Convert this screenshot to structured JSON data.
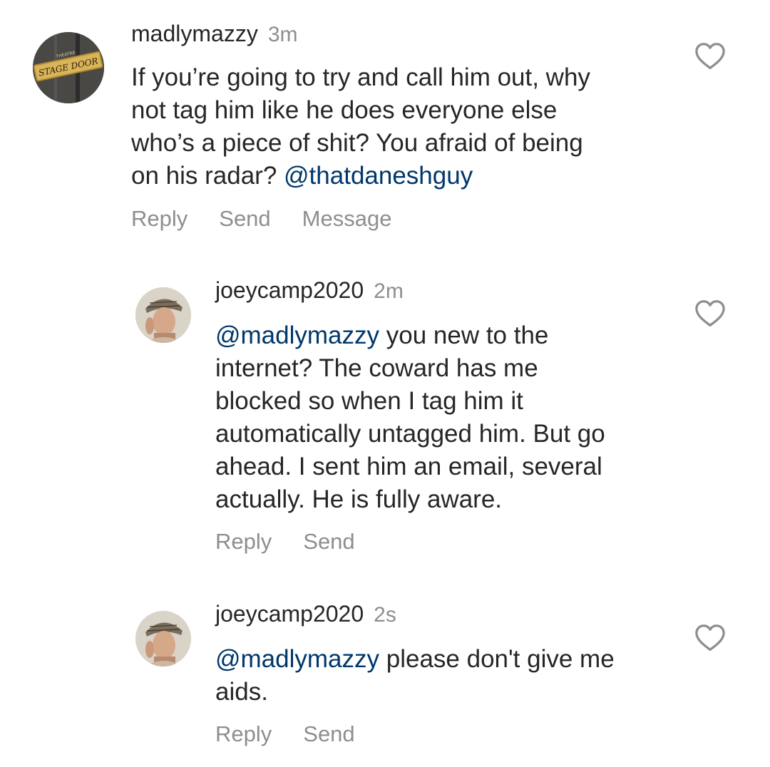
{
  "comments": [
    {
      "username": "madlymazzy",
      "time": "3m",
      "text_lines": [
        [
          {
            "t": "If you’re going to try and call him out, why"
          }
        ],
        [
          {
            "t": "not tag him like he does everyone else"
          }
        ],
        [
          {
            "t": "who’s a piece of shit? You afraid of being"
          }
        ],
        [
          {
            "t": "on his radar? "
          },
          {
            "t": "@thatdaneshguy",
            "m": true
          }
        ]
      ],
      "actions": [
        "Reply",
        "Send",
        "Message"
      ],
      "avatar_sign_top": "THEATRE",
      "avatar_sign_main": "STAGE DOOR"
    },
    {
      "username": "joeycamp2020",
      "time": "2m",
      "text_lines": [
        [
          {
            "t": "@madlymazzy",
            "m": true
          },
          {
            "t": " you new to the"
          }
        ],
        [
          {
            "t": "internet? The coward has me"
          }
        ],
        [
          {
            "t": "blocked so when I tag him it"
          }
        ],
        [
          {
            "t": "automatically untagged him. But go"
          }
        ],
        [
          {
            "t": "ahead. I sent him an email, several"
          }
        ],
        [
          {
            "t": "actually. He is fully aware."
          }
        ]
      ],
      "actions": [
        "Reply",
        "Send"
      ]
    },
    {
      "username": "joeycamp2020",
      "time": "2s",
      "text_lines": [
        [
          {
            "t": "@madlymazzy",
            "m": true
          },
          {
            "t": " please don't give me"
          }
        ],
        [
          {
            "t": "aids."
          }
        ]
      ],
      "actions": [
        "Reply",
        "Send"
      ]
    }
  ],
  "colors": {
    "text": "#262626",
    "muted": "#8e8e8e",
    "mention": "#00376b"
  },
  "icons": {
    "like": "heart-outline-icon"
  }
}
